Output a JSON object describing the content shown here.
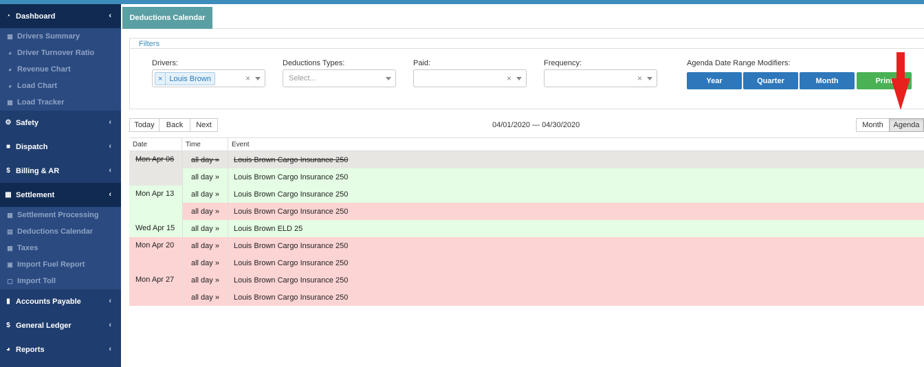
{
  "sidebar": {
    "items": [
      {
        "label": "Dashboard",
        "icon": "dashboard-icon"
      },
      {
        "label": "Drivers Summary",
        "icon": "grid-icon"
      },
      {
        "label": "Driver Turnover Ratio",
        "icon": "pie-chart-icon"
      },
      {
        "label": "Revenue Chart",
        "icon": "pie-chart-icon"
      },
      {
        "label": "Load Chart",
        "icon": "pie-chart-icon"
      },
      {
        "label": "Load Tracker",
        "icon": "grid-icon"
      },
      {
        "label": "Safety",
        "icon": "cogs-icon"
      },
      {
        "label": "Dispatch",
        "icon": "truck-icon"
      },
      {
        "label": "Billing & AR",
        "icon": "dollar-icon"
      },
      {
        "label": "Settlement",
        "icon": "calculator-icon"
      },
      {
        "label": "Settlement Processing",
        "icon": "table-icon"
      },
      {
        "label": "Deductions Calendar",
        "icon": "calendar-icon"
      },
      {
        "label": "Taxes",
        "icon": "table-icon"
      },
      {
        "label": "Import Fuel Report",
        "icon": "file-excel-icon"
      },
      {
        "label": "Import Toll",
        "icon": "file-icon"
      },
      {
        "label": "Accounts Payable",
        "icon": "book-icon"
      },
      {
        "label": "General Ledger",
        "icon": "dollar-icon"
      },
      {
        "label": "Reports",
        "icon": "pie-chart-icon"
      }
    ]
  },
  "tab": {
    "label": "Deductions Calendar"
  },
  "filters": {
    "title": "Filters",
    "drivers_label": "Drivers:",
    "drivers_chip": "Louis Brown",
    "types_label": "Deductions Types:",
    "types_placeholder": "Select...",
    "paid_label": "Paid:",
    "frequency_label": "Frequency:",
    "modifiers_label": "Agenda Date Range Modifiers:",
    "year": "Year",
    "quarter": "Quarter",
    "month": "Month",
    "print": "Print",
    "clear_glyph": "×",
    "chip_remove": "×"
  },
  "toolbar": {
    "today": "Today",
    "back": "Back",
    "next": "Next",
    "range": "04/01/2020 — 04/30/2020",
    "month_view": "Month",
    "agenda_view": "Agenda"
  },
  "agenda": {
    "headers": {
      "date": "Date",
      "time": "Time",
      "event": "Event"
    },
    "dates": [
      "Mon Apr 06",
      "Mon Apr 13",
      "Wed Apr 15",
      "Mon Apr 20",
      "Mon Apr 27"
    ],
    "rows": [
      {
        "time": "all day »",
        "event": "Louis Brown Cargo Insurance 250",
        "status": "grey"
      },
      {
        "time": "all day »",
        "event": "Louis Brown Cargo Insurance 250",
        "status": "green"
      },
      {
        "time": "all day »",
        "event": "Louis Brown Cargo Insurance 250",
        "status": "green"
      },
      {
        "time": "all day »",
        "event": "Louis Brown Cargo Insurance 250",
        "status": "red"
      },
      {
        "time": "all day »",
        "event": "Louis Brown ELD 25",
        "status": "green"
      },
      {
        "time": "all day »",
        "event": "Louis Brown Cargo Insurance 250",
        "status": "red"
      },
      {
        "time": "all day »",
        "event": "Louis Brown Cargo Insurance 250",
        "status": "red"
      },
      {
        "time": "all day »",
        "event": "Louis Brown Cargo Insurance 250",
        "status": "red"
      },
      {
        "time": "all day »",
        "event": "Louis Brown Cargo Insurance 250",
        "status": "red"
      }
    ]
  },
  "colors": {
    "accent": "#3c8dbc",
    "sidebar": "#1f3d6e",
    "paid": "#e4fde4",
    "unpaid": "#fdd4d4",
    "past": "#e8e6e3",
    "arrow": "#e8201e"
  }
}
